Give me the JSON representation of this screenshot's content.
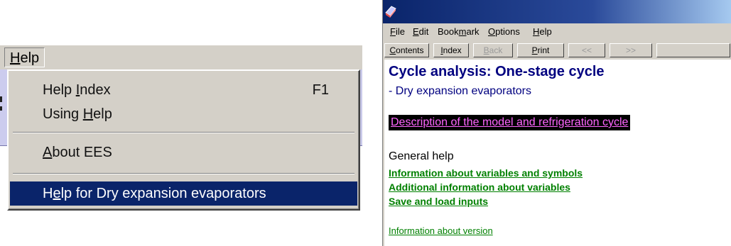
{
  "menu": {
    "help_label": "Help",
    "items": [
      {
        "label": "Help Index",
        "accel": "F1"
      },
      {
        "label": "Using Help"
      },
      {
        "label": "About EES"
      },
      {
        "label": "Help for Dry expansion evaporators"
      }
    ],
    "selected_index": 3
  },
  "help_window": {
    "menubar": [
      "File",
      "Edit",
      "Bookmark",
      "Options",
      "Help"
    ],
    "toolbar": [
      {
        "label": "Contents",
        "enabled": true
      },
      {
        "label": "Index",
        "enabled": true
      },
      {
        "label": "Back",
        "enabled": false
      },
      {
        "label": "Print",
        "enabled": true
      },
      {
        "label": "<<",
        "enabled": false
      },
      {
        "label": ">>",
        "enabled": false
      }
    ],
    "title": "Cycle analysis: One-stage cycle",
    "subtitle": "- Dry expansion evaporators",
    "description_link": "Description of the model and refrigeration cycle",
    "general_help": "General help",
    "links": [
      "Information about variables and symbols",
      "Additional information about variables",
      "Save and load inputs"
    ],
    "version_link": "Information about version"
  },
  "colors": {
    "selection": "#0a246a",
    "title_text": "#000080",
    "link_green": "#008000",
    "desc_link": "#ff66ff"
  }
}
